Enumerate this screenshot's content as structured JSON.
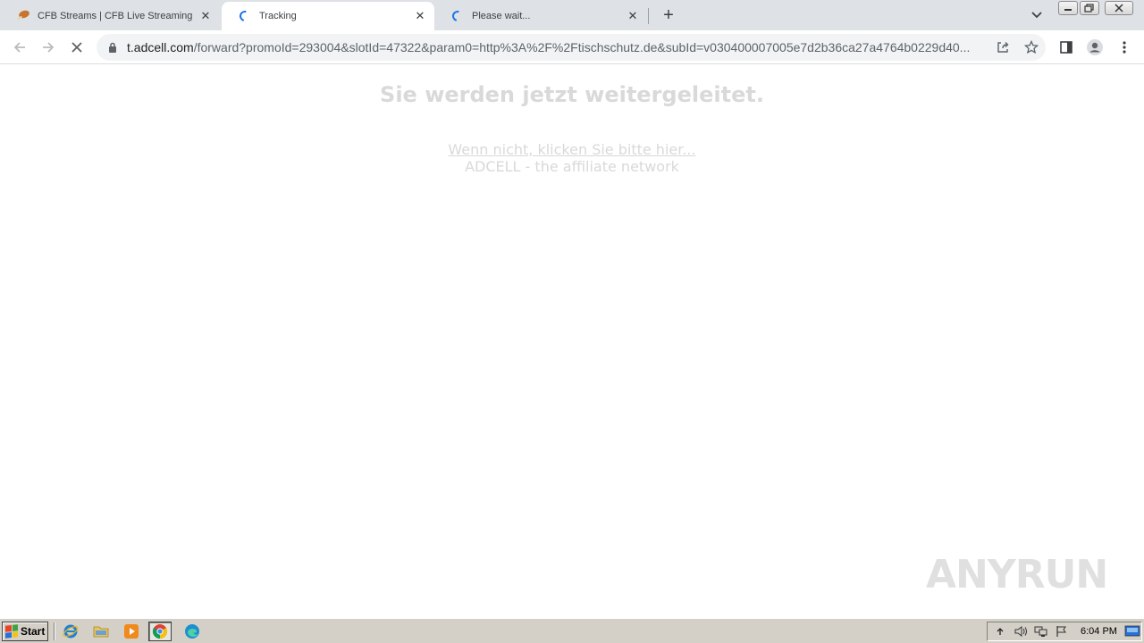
{
  "browser": {
    "tabs": [
      {
        "title": "CFB Streams | CFB Live Streaming - ",
        "state": "idle"
      },
      {
        "title": "Tracking",
        "state": "loading"
      },
      {
        "title": "Please wait...",
        "state": "loading"
      }
    ],
    "new_tab_label": "+",
    "url_host": "t.adcell.com",
    "url_rest": "/forward?promoId=293004&slotId=47322&param0=http%3A%2F%2Ftischschutz.de&subId=v030400007005e7d2b36ca27a4764b0229d40..."
  },
  "page": {
    "headline": "Sie werden jetzt weitergeleitet.",
    "link_text": "Wenn nicht, klicken Sie bitte hier...",
    "subtext": "ADCELL - the affiliate network"
  },
  "watermark": {
    "left": "ANY",
    "right": "RUN"
  },
  "taskbar": {
    "start_label": "Start",
    "clock": "6:04 PM"
  },
  "colors": {
    "chrome_frame": "#dee1e6",
    "faint_text": "#d9d9d9",
    "spinner_blue": "#1a73e8",
    "taskbar": "#d4d0c8"
  },
  "icons": [
    "chicken-leg-favicon-icon",
    "loading-spinner-icon",
    "close-icon",
    "plus-icon",
    "chevron-down-icon",
    "back-arrow-icon",
    "forward-arrow-icon",
    "stop-icon",
    "lock-icon",
    "share-icon",
    "star-icon",
    "side-panel-icon",
    "profile-icon",
    "kebab-menu-icon",
    "windows-flag-icon",
    "ie-icon",
    "folder-icon",
    "media-player-icon",
    "chrome-icon",
    "edge-icon",
    "volume-icon",
    "network-icon",
    "flag-icon",
    "show-desktop-icon"
  ]
}
